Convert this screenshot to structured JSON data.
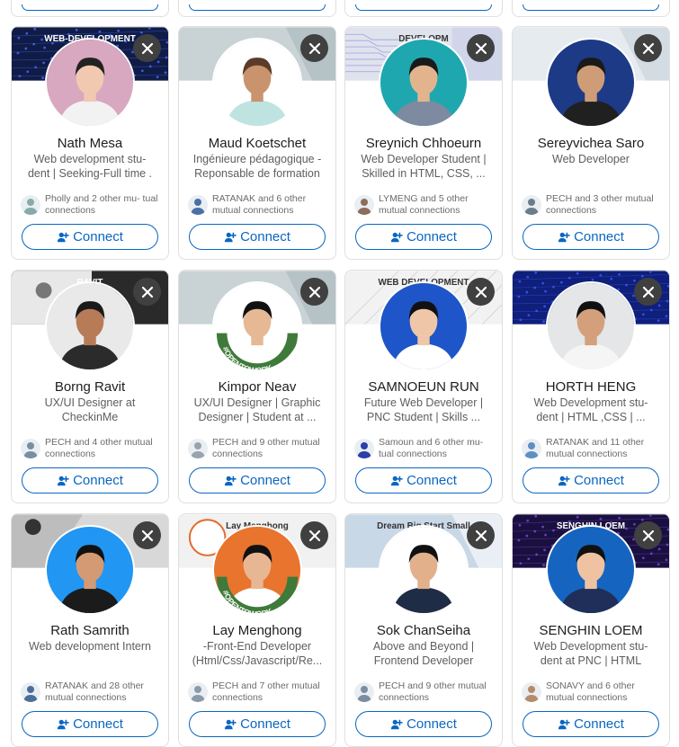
{
  "connect_label": "Connect",
  "colors": {
    "accent": "#0a66c2",
    "dismiss_bg": "#404040"
  },
  "cards": [
    {
      "name": "Nath Mesa",
      "headline": "Web development stu- dent | Seeking-Full time .",
      "mutual": "Pholly and 2 other mu- tual connections",
      "cover_text": "WEB-DEVELOPMENT"
    },
    {
      "name": "Maud Koetschet",
      "headline": "Ingénieure pédagogique - Reponsable de formation",
      "mutual": "RATANAK and 6 other mutual connections",
      "cover_text": ""
    },
    {
      "name": "Sreynich Chhoeurn",
      "headline": "Web Developer Student | Skilled in HTML, CSS, ...",
      "mutual": "LYMENG and 5 other mutual connections",
      "cover_text": "DEVELOPM"
    },
    {
      "name": "Sereyvichea Saro",
      "headline": "Web Developer",
      "mutual": "PECH and 3 other mutual connections",
      "cover_text": ""
    },
    {
      "name": "Borng Ravit",
      "headline": "UX/UI Designer at CheckinMe",
      "mutual": "PECH and 4 other mutual connections",
      "cover_text": "RAVIT"
    },
    {
      "name": "Kimpor Neav",
      "headline": "UX/UI Designer | Graphic Designer | Student at ...",
      "mutual": "PECH and 9 other mutual connections",
      "cover_text": "",
      "badge": "#OPENTOWORK"
    },
    {
      "name": "SAMNOEUN RUN",
      "headline": "Future Web Developer | PNC Student | Skills ...",
      "mutual": "Samoun and 6 other mu- tual connections",
      "cover_text": "WEB DEVELOPMENT"
    },
    {
      "name": "HORTH HENG",
      "headline": "Web Development stu- dent | HTML ,CSS | ...",
      "mutual": "RATANAK and 11 other mutual connections",
      "cover_text": ""
    },
    {
      "name": "Rath Samrith",
      "headline": "Web development Intern",
      "mutual": "RATANAK and 28 other mutual connections",
      "cover_text": ""
    },
    {
      "name": "Lay Menghong",
      "headline": "-Front-End Developer (Html/Css/Javascript/Re...",
      "mutual": "PECH and 7 other mutual connections",
      "cover_text": "Lay Menghong",
      "badge": "#OPENTOWORK"
    },
    {
      "name": "Sok ChanSeiha",
      "headline": "Above and Beyond | Frontend Developer",
      "mutual": "PECH and 9 other mutual connections",
      "cover_text": "Dream Big Start Small"
    },
    {
      "name": "SENGHIN LOEM",
      "headline": "Web Development stu- dent at PNC | HTML CSS...",
      "mutual": "SONAVY and 6 other mutual connections",
      "cover_text": "SENGHIN LOEM"
    }
  ]
}
